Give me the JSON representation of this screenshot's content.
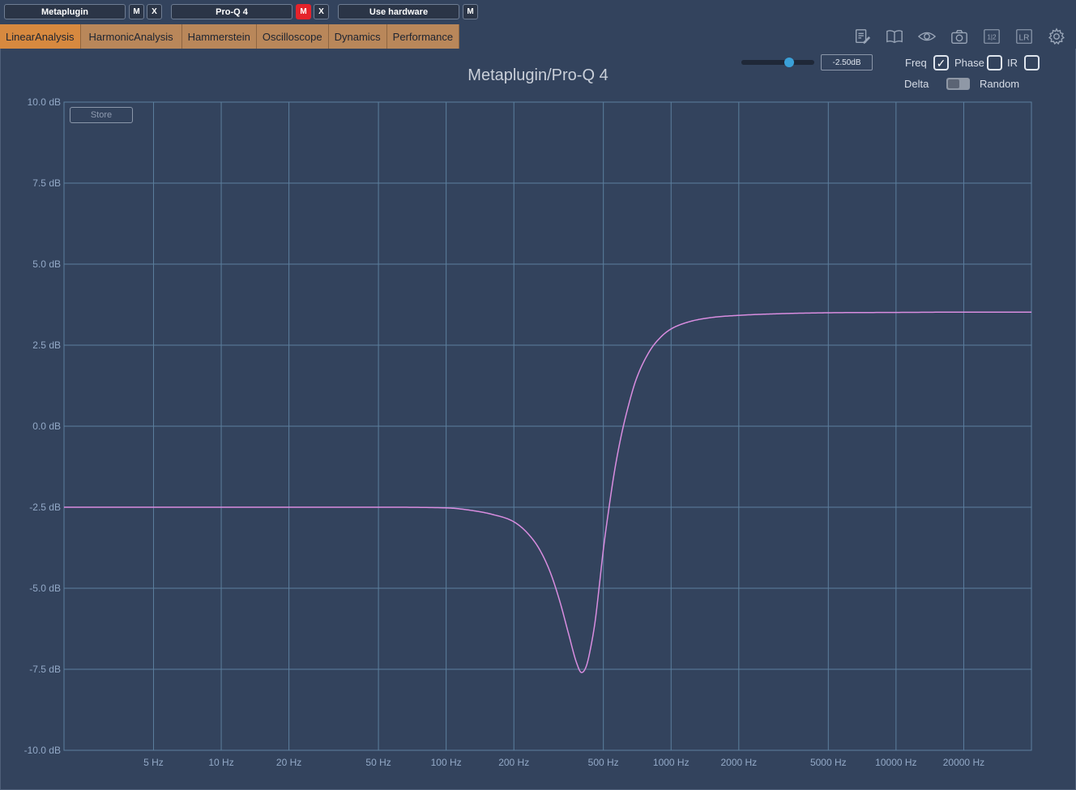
{
  "slots": [
    {
      "name": "Metaplugin",
      "buttons": [
        "M",
        "X"
      ],
      "mute_active": false
    },
    {
      "name": "Pro-Q 4",
      "buttons": [
        "M",
        "X"
      ],
      "mute_active": true
    },
    {
      "name": "Use hardware",
      "buttons": [
        "M"
      ],
      "mute_active": false
    }
  ],
  "tabs": [
    "LinearAnalysis",
    "HarmonicAnalysis",
    "Hammerstein",
    "Oscilloscope",
    "Dynamics",
    "Performance"
  ],
  "active_tab": "LinearAnalysis",
  "toolbar_icons": [
    "notes-icon",
    "book-icon",
    "eye-icon",
    "camera-icon",
    "one-half-icon",
    "lr-icon",
    "gear-icon"
  ],
  "toolbar_text": {
    "one_half": "1|2",
    "lr": "LR"
  },
  "controls": {
    "gain_value": "-2.50dB",
    "gain_slider_fraction": 0.66,
    "freq_label": "Freq",
    "freq_checked": true,
    "phase_label": "Phase",
    "phase_checked": false,
    "ir_label": "IR",
    "ir_checked": false,
    "delta_label": "Delta",
    "delta_on": false,
    "random_label": "Random",
    "store_label": "Store"
  },
  "colors": {
    "background": "#33435d",
    "grid": "#5c7f9e",
    "curve": "#d98de0",
    "tab": "#b9875a",
    "tab_active": "#d7893f",
    "mute_active": "#e5232b"
  },
  "chart_data": {
    "type": "line",
    "title": "Metaplugin/Pro-Q 4",
    "xscale": "log",
    "xlim": [
      2,
      40000
    ],
    "ylim": [
      -10,
      10
    ],
    "ytick_values": [
      10,
      7.5,
      5,
      2.5,
      0,
      -2.5,
      -5,
      -7.5,
      -10
    ],
    "ytick_labels": [
      "10.0 dB",
      "7.5 dB",
      "5.0 dB",
      "2.5 dB",
      "0.0 dB",
      "-2.5 dB",
      "-5.0 dB",
      "-7.5 dB",
      "-10.0 dB"
    ],
    "xtick_values": [
      5,
      10,
      20,
      50,
      100,
      200,
      500,
      1000,
      2000,
      5000,
      10000,
      20000
    ],
    "xtick_labels": [
      "5 Hz",
      "10 Hz",
      "20 Hz",
      "50 Hz",
      "100 Hz",
      "200 Hz",
      "500 Hz",
      "1000 Hz",
      "2000 Hz",
      "5000 Hz",
      "10000 Hz",
      "20000 Hz"
    ],
    "grid": true,
    "series": [
      {
        "x": [
          2,
          20,
          50,
          100,
          130,
          160,
          200,
          230,
          260,
          290,
          320,
          350,
          380,
          400,
          420,
          440,
          460,
          480,
          500,
          530,
          560,
          600,
          650,
          700,
          800,
          900,
          1000,
          1200,
          1500,
          2000,
          3000,
          5000,
          10000,
          20000,
          40000
        ],
        "y": [
          -2.5,
          -2.5,
          -2.5,
          -2.52,
          -2.6,
          -2.72,
          -2.95,
          -3.3,
          -3.8,
          -4.5,
          -5.4,
          -6.4,
          -7.3,
          -7.6,
          -7.4,
          -6.8,
          -6.0,
          -4.9,
          -3.8,
          -2.5,
          -1.4,
          -0.3,
          0.7,
          1.45,
          2.3,
          2.75,
          3.0,
          3.22,
          3.35,
          3.42,
          3.47,
          3.5,
          3.51,
          3.52,
          3.52
        ]
      }
    ]
  }
}
